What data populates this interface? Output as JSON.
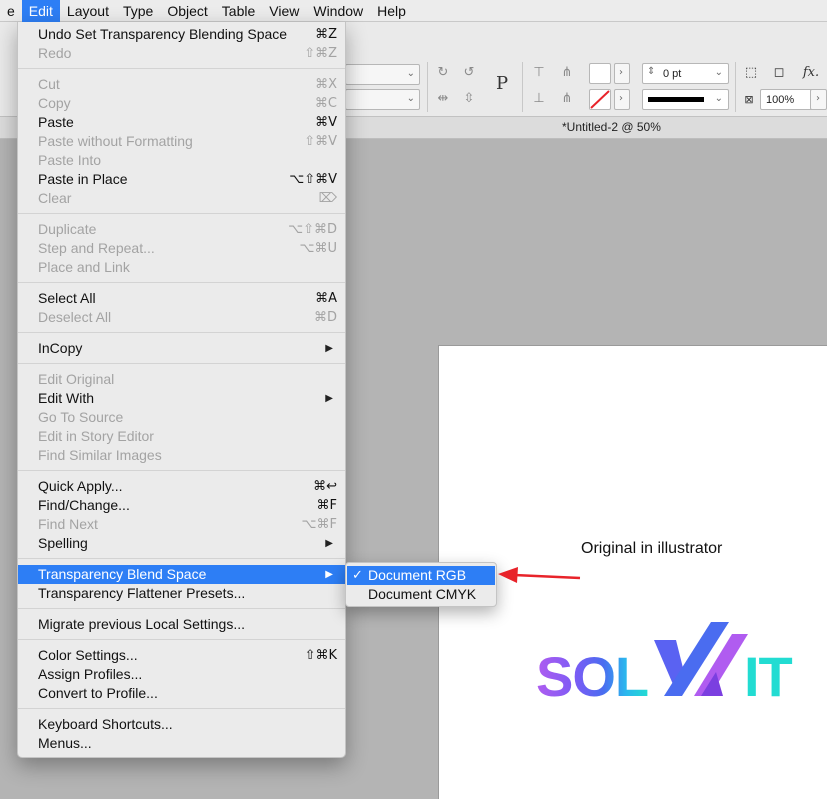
{
  "menubar": {
    "items": [
      "e",
      "Edit",
      "Layout",
      "Type",
      "Object",
      "Table",
      "View",
      "Window",
      "Help"
    ],
    "active_index": 1
  },
  "control_panel": {
    "stroke_weight": "0 pt",
    "opacity": "100%",
    "text_frame_glyph": "P",
    "effects_label": "fx."
  },
  "document": {
    "title": "*Untitled-2 @ 50%",
    "caption": "Original in illustrator",
    "logo_text": "SOLVIT",
    "logo_colors": [
      "#b05cf0",
      "#7b5cf5",
      "#4a6cf0",
      "#2bb7ee",
      "#22dcd2"
    ]
  },
  "edit_menu": {
    "items": [
      {
        "type": "item",
        "label": "Undo Set Transparency Blending Space",
        "shortcut": "⌘Z",
        "enabled": true
      },
      {
        "type": "item",
        "label": "Redo",
        "shortcut": "⇧⌘Z",
        "enabled": false
      },
      {
        "type": "separator"
      },
      {
        "type": "item",
        "label": "Cut",
        "shortcut": "⌘X",
        "enabled": false
      },
      {
        "type": "item",
        "label": "Copy",
        "shortcut": "⌘C",
        "enabled": false
      },
      {
        "type": "item",
        "label": "Paste",
        "shortcut": "⌘V",
        "enabled": true
      },
      {
        "type": "item",
        "label": "Paste without Formatting",
        "shortcut": "⇧⌘V",
        "enabled": false
      },
      {
        "type": "item",
        "label": "Paste Into",
        "shortcut": "",
        "enabled": false
      },
      {
        "type": "item",
        "label": "Paste in Place",
        "shortcut": "⌥⇧⌘V",
        "enabled": true
      },
      {
        "type": "item",
        "label": "Clear",
        "shortcut": "⌦",
        "enabled": false
      },
      {
        "type": "separator"
      },
      {
        "type": "item",
        "label": "Duplicate",
        "shortcut": "⌥⇧⌘D",
        "enabled": false
      },
      {
        "type": "item",
        "label": "Step and Repeat...",
        "shortcut": "⌥⌘U",
        "enabled": false
      },
      {
        "type": "item",
        "label": "Place and Link",
        "shortcut": "",
        "enabled": false
      },
      {
        "type": "separator"
      },
      {
        "type": "item",
        "label": "Select All",
        "shortcut": "⌘A",
        "enabled": true
      },
      {
        "type": "item",
        "label": "Deselect All",
        "shortcut": "⌘D",
        "enabled": false
      },
      {
        "type": "separator"
      },
      {
        "type": "item",
        "label": "InCopy",
        "shortcut": "",
        "enabled": true,
        "submenu": true
      },
      {
        "type": "separator"
      },
      {
        "type": "item",
        "label": "Edit Original",
        "shortcut": "",
        "enabled": false
      },
      {
        "type": "item",
        "label": "Edit With",
        "shortcut": "",
        "enabled": true,
        "submenu": true
      },
      {
        "type": "item",
        "label": "Go To Source",
        "shortcut": "",
        "enabled": false
      },
      {
        "type": "item",
        "label": "Edit in Story Editor",
        "shortcut": "",
        "enabled": false
      },
      {
        "type": "item",
        "label": "Find Similar Images",
        "shortcut": "",
        "enabled": false
      },
      {
        "type": "separator"
      },
      {
        "type": "item",
        "label": "Quick Apply...",
        "shortcut": "⌘↩",
        "enabled": true
      },
      {
        "type": "item",
        "label": "Find/Change...",
        "shortcut": "⌘F",
        "enabled": true
      },
      {
        "type": "item",
        "label": "Find Next",
        "shortcut": "⌥⌘F",
        "enabled": false
      },
      {
        "type": "item",
        "label": "Spelling",
        "shortcut": "",
        "enabled": true,
        "submenu": true
      },
      {
        "type": "separator"
      },
      {
        "type": "item",
        "label": "Transparency Blend Space",
        "shortcut": "",
        "enabled": true,
        "submenu": true,
        "highlighted": true
      },
      {
        "type": "item",
        "label": "Transparency Flattener Presets...",
        "shortcut": "",
        "enabled": true
      },
      {
        "type": "separator"
      },
      {
        "type": "item",
        "label": "Migrate previous Local Settings...",
        "shortcut": "",
        "enabled": true
      },
      {
        "type": "separator"
      },
      {
        "type": "item",
        "label": "Color Settings...",
        "shortcut": "⇧⌘K",
        "enabled": true
      },
      {
        "type": "item",
        "label": "Assign Profiles...",
        "shortcut": "",
        "enabled": true
      },
      {
        "type": "item",
        "label": "Convert to Profile...",
        "shortcut": "",
        "enabled": true
      },
      {
        "type": "separator"
      },
      {
        "type": "item",
        "label": "Keyboard Shortcuts...",
        "shortcut": "",
        "enabled": true
      },
      {
        "type": "item",
        "label": "Menus...",
        "shortcut": "",
        "enabled": true
      }
    ]
  },
  "submenu": {
    "items": [
      {
        "label": "Document RGB",
        "checked": true,
        "highlighted": true
      },
      {
        "label": "Document CMYK",
        "checked": false,
        "highlighted": false
      }
    ],
    "check_glyph": "✓"
  },
  "annotation": {
    "arrow_color": "#e8232a"
  },
  "colors": {
    "menu_highlight": "#2d7ef5",
    "menu_bg": "#ebebeb",
    "disabled_text": "#a3a3a3"
  }
}
